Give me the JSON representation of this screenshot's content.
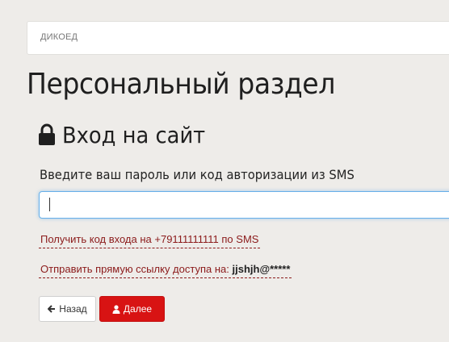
{
  "breadcrumb": {
    "items": [
      "ДИКОЕД"
    ]
  },
  "page": {
    "title": "Персональный раздел"
  },
  "login": {
    "section_title": "Вход на сайт",
    "field_label": "Введите ваш пароль или код авторизации из SMS",
    "code_input": {
      "value": "",
      "placeholder": ""
    },
    "sms_link": "Получить код входа на +79111111111 по SMS",
    "email_link_prefix": "Отправить прямую ссылку доступа на: ",
    "email_masked": "jjshjh@*****",
    "back_button": "Назад",
    "next_button": "Далее"
  },
  "icons": {
    "section": "lock-icon",
    "back": "arrow-left-icon",
    "next": "user-icon"
  },
  "colors": {
    "accent": "#d81313",
    "link": "#8b1a1a",
    "focus": "#66afe9"
  }
}
